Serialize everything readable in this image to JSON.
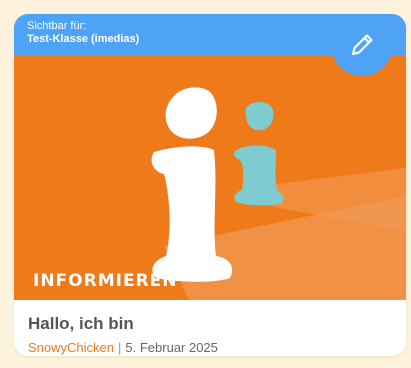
{
  "card": {
    "visibility_label": "Sichtbar für:",
    "visibility_value": "Test-Klasse (imedias)",
    "image_caption": "INFORMIEREN",
    "title": "Hallo, ich bin",
    "author": "SnowyChicken",
    "separator": "|",
    "date": "5. Februar 2025",
    "edit_icon": "pencil-icon"
  },
  "colors": {
    "accent_blue": "#4fa3f7",
    "image_orange": "#ef7a1a",
    "author_orange": "#ef7a1a",
    "page_background": "#fdf3dc",
    "icon_teal": "#7ecbd0"
  }
}
